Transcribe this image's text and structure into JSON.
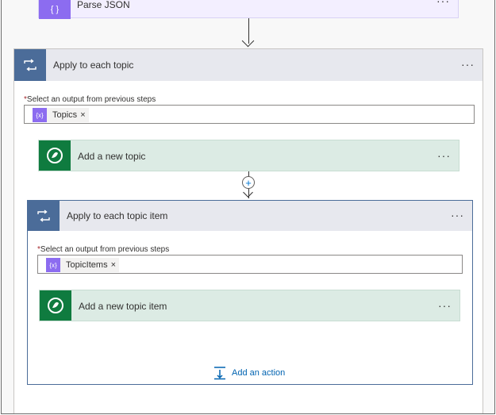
{
  "parse_json": {
    "title": "Parse JSON",
    "icon": "code-braces-icon",
    "menu": "···"
  },
  "outer_loop": {
    "title": "Apply to each topic",
    "icon": "loop-icon",
    "menu": "···",
    "required_mark": "*",
    "field_label": "Select an output from previous steps",
    "token": {
      "label": "Topics",
      "icon": "expression-icon",
      "remove": "×"
    }
  },
  "add_topic": {
    "title": "Add a new topic",
    "icon": "dataverse-icon",
    "menu": "···"
  },
  "inner_loop": {
    "title": "Apply to each topic item",
    "icon": "loop-icon",
    "menu": "···",
    "required_mark": "*",
    "field_label": "Select an output from previous steps",
    "token": {
      "label": "TopicItems",
      "icon": "expression-icon",
      "remove": "×"
    }
  },
  "add_topic_item": {
    "title": "Add a new topic item",
    "icon": "dataverse-icon",
    "menu": "···"
  },
  "add_action": {
    "label": "Add an action",
    "icon": "add-action-icon"
  },
  "insert_step": {
    "symbol": "+"
  },
  "token_icon_text": "{x}",
  "colors": {
    "loop_blue": "#4b6c99",
    "parse_purple": "#8c6cf0",
    "dataverse_green": "#0f7b3f",
    "link_blue": "#0063b1"
  }
}
